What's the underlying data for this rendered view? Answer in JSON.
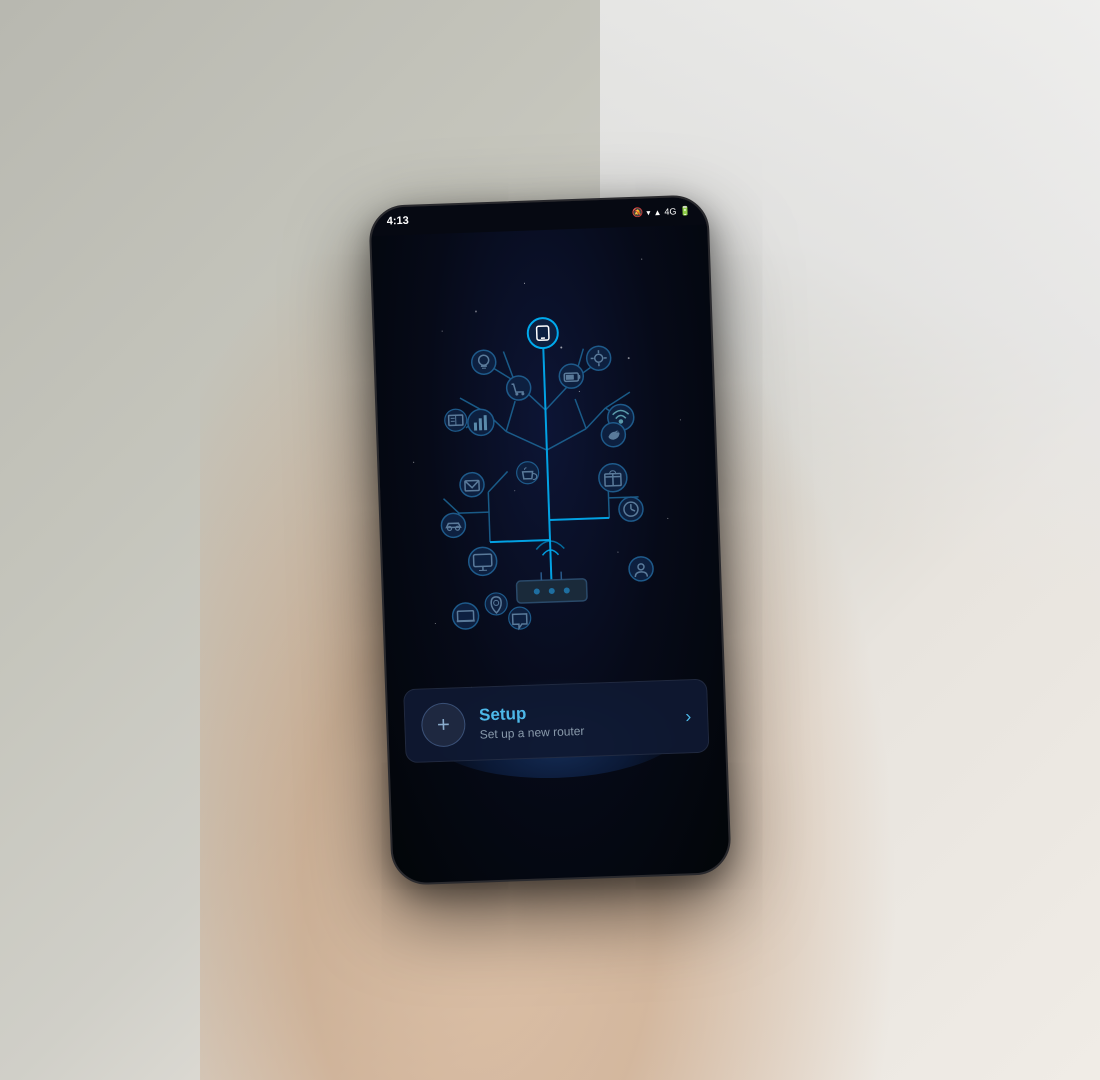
{
  "background": {
    "color": "#c8c8c0"
  },
  "phone": {
    "status_bar": {
      "time": "4:13",
      "icons": "🔕 ▾ 4G 🔋"
    },
    "setup_card": {
      "title": "Setup",
      "subtitle": "Set up a new router",
      "plus_label": "+",
      "chevron": "›"
    }
  }
}
